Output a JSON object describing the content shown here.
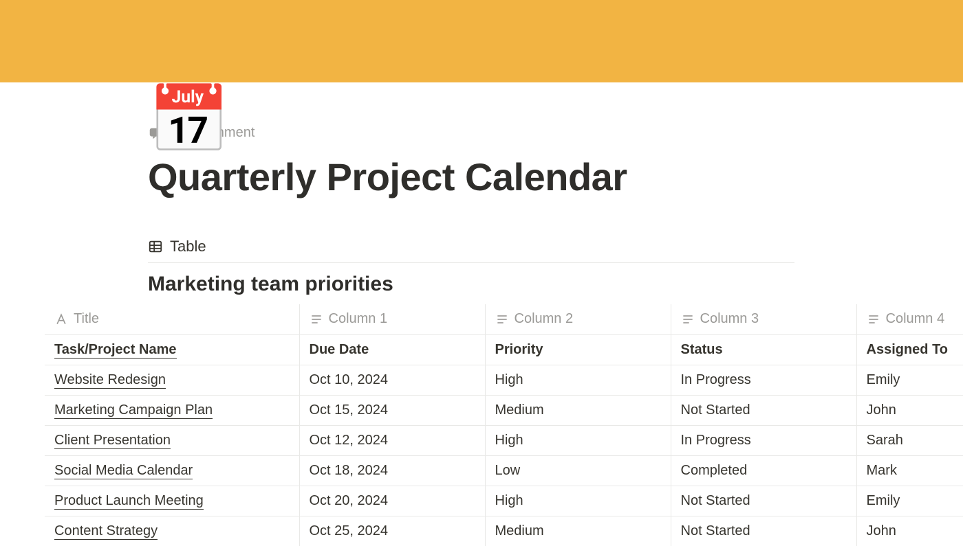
{
  "page": {
    "icon": "📅",
    "add_comment": "Add comment",
    "title": "Quarterly Project Calendar"
  },
  "view": {
    "tab_label": "Table"
  },
  "database": {
    "title": "Marketing team priorities",
    "columns": [
      "Title",
      "Column 1",
      "Column 2",
      "Column 3",
      "Column 4"
    ],
    "rows": [
      {
        "title": "Task/Project Name",
        "c1": "Due Date",
        "c2": "Priority",
        "c3": "Status",
        "c4": "Assigned To",
        "is_header": true
      },
      {
        "title": "Website Redesign",
        "c1": "Oct 10, 2024",
        "c2": "High",
        "c3": "In Progress",
        "c4": "Emily"
      },
      {
        "title": "Marketing Campaign Plan",
        "c1": "Oct 15, 2024",
        "c2": "Medium",
        "c3": "Not Started",
        "c4": "John"
      },
      {
        "title": "Client Presentation",
        "c1": "Oct 12, 2024",
        "c2": "High",
        "c3": "In Progress",
        "c4": "Sarah"
      },
      {
        "title": "Social Media Calendar",
        "c1": "Oct 18, 2024",
        "c2": "Low",
        "c3": "Completed",
        "c4": "Mark"
      },
      {
        "title": "Product Launch Meeting",
        "c1": "Oct 20, 2024",
        "c2": "High",
        "c3": "Not Started",
        "c4": "Emily"
      },
      {
        "title": "Content Strategy",
        "c1": "Oct 25, 2024",
        "c2": "Medium",
        "c3": "Not Started",
        "c4": "John"
      }
    ]
  }
}
